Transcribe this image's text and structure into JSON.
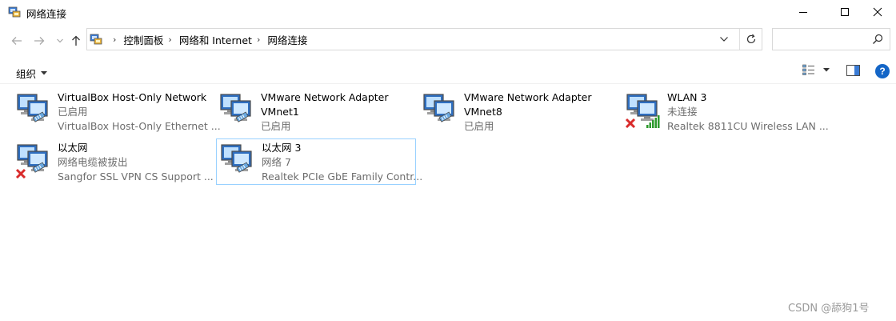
{
  "window": {
    "title": "网络连接"
  },
  "address": {
    "crumbs": [
      "控制面板",
      "网络和 Internet",
      "网络连接"
    ]
  },
  "search": {
    "placeholder": ""
  },
  "toolbar": {
    "organize_label": "组织"
  },
  "help": {
    "label": "?"
  },
  "items": [
    {
      "name": "VirtualBox Host-Only Network",
      "line2": "已启用",
      "line3": "VirtualBox Host-Only Ethernet ...",
      "status": "enabled"
    },
    {
      "name": "VMware Network Adapter",
      "line2": "VMnet1",
      "line3": "已启用",
      "status": "enabled"
    },
    {
      "name": "VMware Network Adapter",
      "line2": "VMnet8",
      "line3": "已启用",
      "status": "enabled"
    },
    {
      "name": "WLAN 3",
      "line2": "未连接",
      "line3": "Realtek 8811CU Wireless LAN ...",
      "status": "disconnected-wifi"
    },
    {
      "name": "以太网",
      "line2": "网络电缆被拔出",
      "line3": "Sangfor SSL VPN CS Support ...",
      "status": "unplugged"
    },
    {
      "name": "以太网 3",
      "line2": "网络 7",
      "line3": "Realtek PCIe GbE Family Contr...",
      "status": "enabled"
    }
  ],
  "watermark": "CSDN @舔狗1号",
  "colors": {
    "selection_border": "#99d1ff",
    "error_red": "#d92b2b",
    "accent_blue": "#1466c7"
  }
}
